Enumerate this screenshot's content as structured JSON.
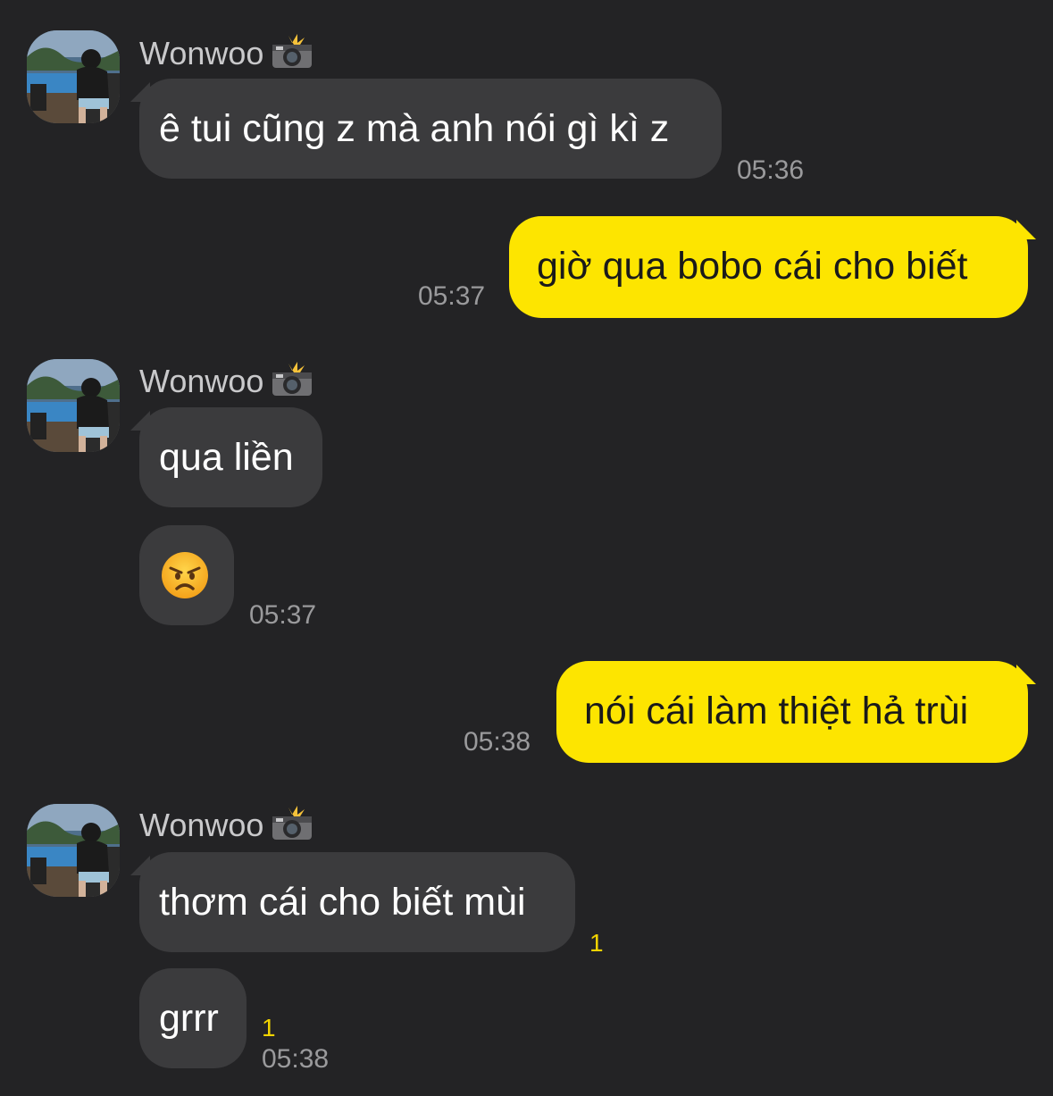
{
  "sender": {
    "name": "Wonwoo",
    "badge_icon": "camera-flash-icon"
  },
  "messages": [
    {
      "text": "ê tui cũng z mà anh nói gì kì z",
      "time": "05:36"
    },
    {
      "text": "giờ qua bobo cái cho biết",
      "time": "05:37"
    },
    {
      "text": "qua liền"
    },
    {
      "emoji": "😠",
      "emoji_icon": "angry-face-icon",
      "time": "05:37"
    },
    {
      "text": "nói cái làm thiệt hả trùi",
      "time": "05:38"
    },
    {
      "text": "thơm cái cho biết mùi",
      "unread": "1"
    },
    {
      "text": "grrr",
      "unread": "1",
      "time": "05:38"
    }
  ],
  "colors": {
    "background": "#232325",
    "incoming": "#3b3b3d",
    "outgoing": "#fde500",
    "unread": "#f2d400"
  }
}
